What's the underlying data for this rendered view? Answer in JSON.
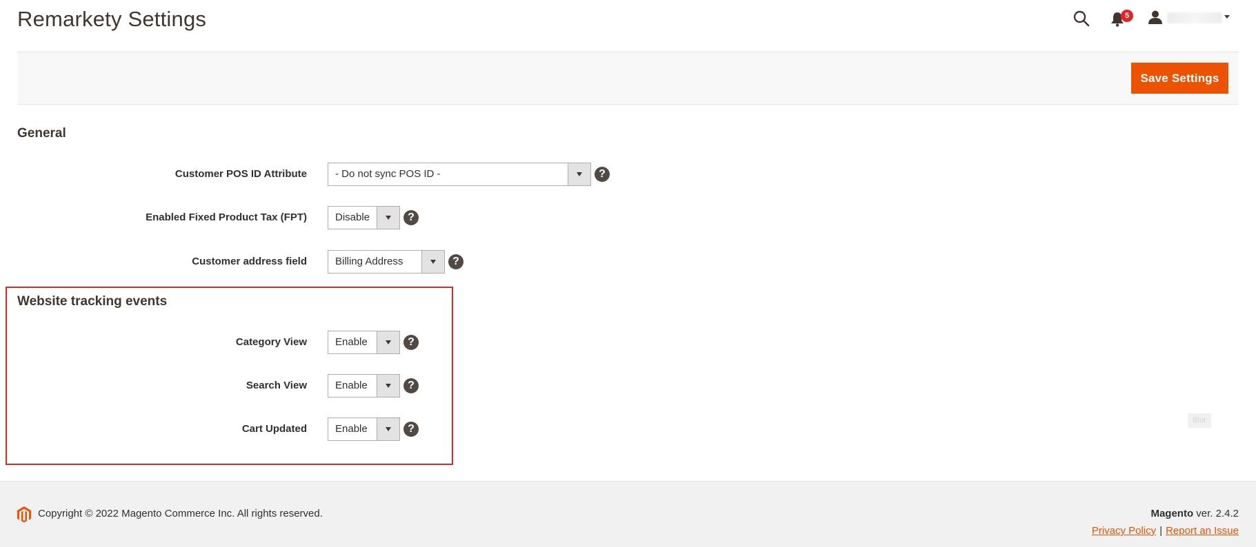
{
  "page": {
    "title": "Remarkety Settings"
  },
  "header": {
    "notifications_count": "5",
    "icons": [
      "search-icon",
      "bell-icon",
      "user-icon",
      "chevron-down-icon"
    ]
  },
  "toolbar": {
    "save_label": "Save Settings"
  },
  "general": {
    "title": "General",
    "fields": [
      {
        "label": "Customer POS ID Attribute",
        "value": "- Do not sync POS ID -"
      },
      {
        "label": "Enabled Fixed Product Tax (FPT)",
        "value": "Disable"
      },
      {
        "label": "Customer address field",
        "value": "Billing Address"
      }
    ]
  },
  "tracking": {
    "title": "Website tracking events",
    "fields": [
      {
        "label": "Category View",
        "value": "Enable"
      },
      {
        "label": "Search View",
        "value": "Enable"
      },
      {
        "label": "Cart Updated",
        "value": "Enable"
      }
    ]
  },
  "help_glyph": "?",
  "blur_tag": "Blur",
  "footer": {
    "copyright": "Copyright © 2022 Magento Commerce Inc. All rights reserved.",
    "brand": "Magento",
    "version": " ver. 2.4.2",
    "privacy_link": "Privacy Policy",
    "separator": "|",
    "report_link": "Report an Issue"
  },
  "colors": {
    "accent": "#eb5202",
    "badge": "#e22626",
    "highlight_border": "#e22626",
    "help_icon": "#514943"
  }
}
